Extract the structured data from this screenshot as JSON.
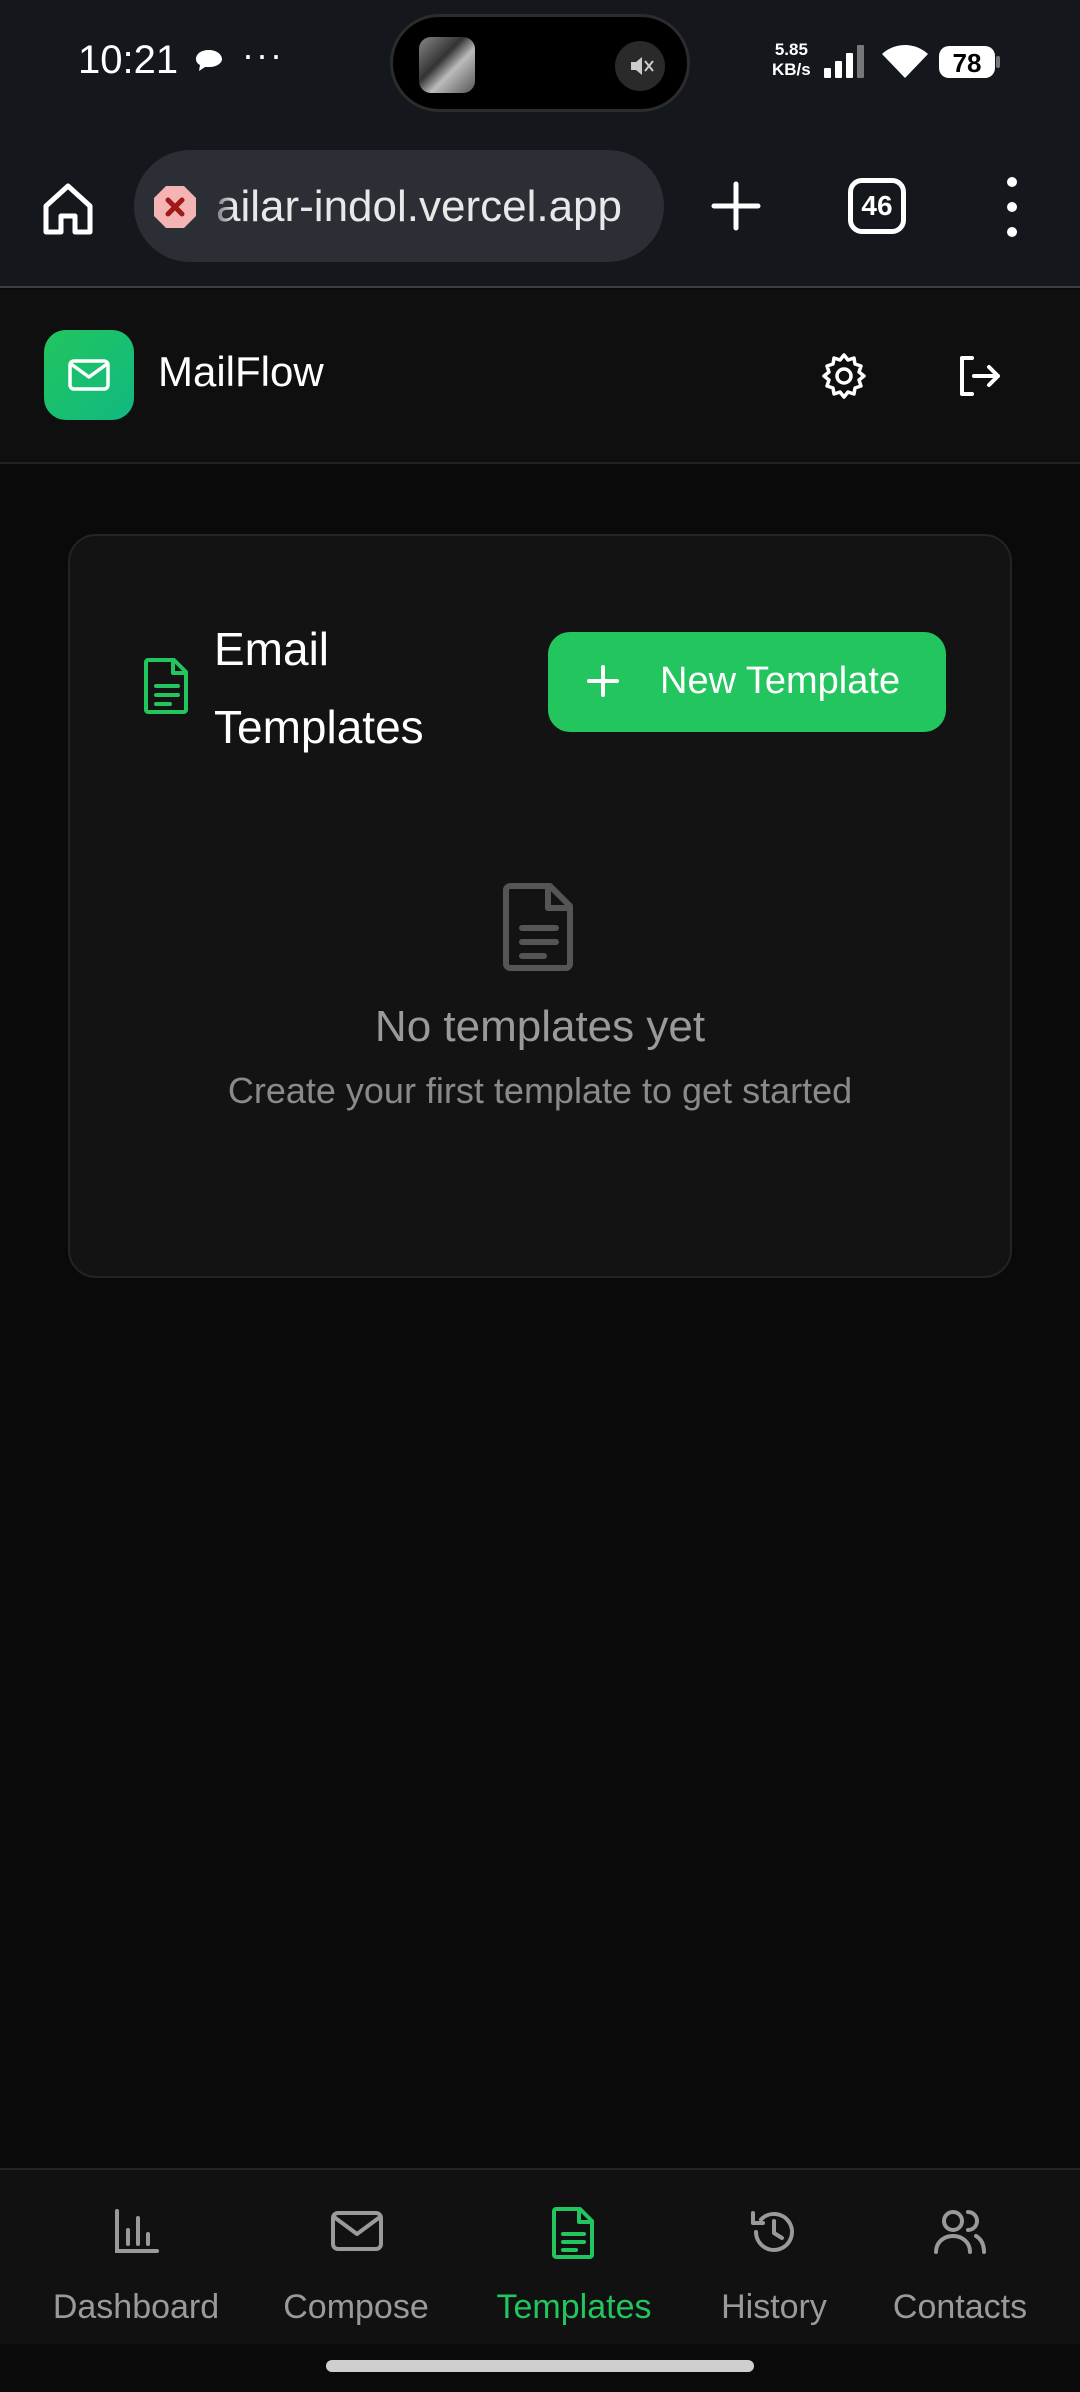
{
  "status_bar": {
    "time": "10:21",
    "network_speed_value": "5.85",
    "network_speed_unit": "KB/s",
    "battery": "78"
  },
  "browser": {
    "url": "ailar-indol.vercel.app",
    "tab_count": "46"
  },
  "app": {
    "name": "MailFlow",
    "brand_color": "#22c55e"
  },
  "templates_card": {
    "title": "Email Templates",
    "new_button_label": "New Template",
    "empty_title": "No templates yet",
    "empty_subtitle": "Create your first template to get started"
  },
  "bottom_nav": {
    "items": [
      {
        "label": "Dashboard",
        "icon": "bar-chart-icon",
        "active": false
      },
      {
        "label": "Compose",
        "icon": "mail-icon",
        "active": false
      },
      {
        "label": "Templates",
        "icon": "file-text-icon",
        "active": true
      },
      {
        "label": "History",
        "icon": "history-icon",
        "active": false
      },
      {
        "label": "Contacts",
        "icon": "users-icon",
        "active": false
      }
    ]
  }
}
